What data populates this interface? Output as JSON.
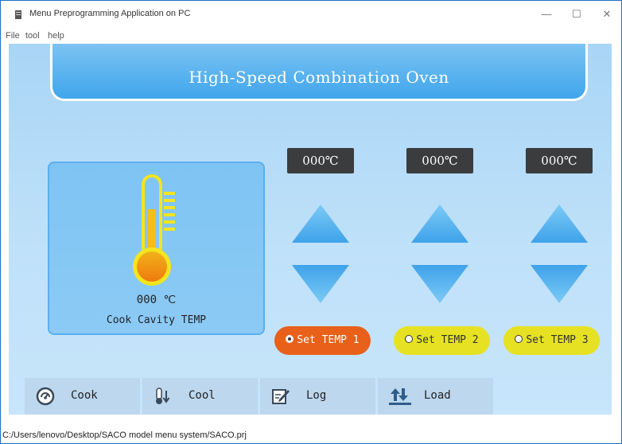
{
  "window": {
    "title": "Menu Preprogramming Application on PC",
    "controls": {
      "minimize": "—",
      "maximize": "☐",
      "close": "✕"
    }
  },
  "menu": [
    "File",
    "tool",
    "help"
  ],
  "header": {
    "title": "High-Speed Combination Oven"
  },
  "cavity": {
    "icon": "thermometer-icon",
    "value": "000 ℃",
    "label": "Cook Cavity TEMP"
  },
  "temps": [
    {
      "display": "000℃",
      "button_label": "Set TEMP 1",
      "selected": true
    },
    {
      "display": "000℃",
      "button_label": "Set TEMP 2",
      "selected": false
    },
    {
      "display": "000℃",
      "button_label": "Set TEMP 3",
      "selected": false
    }
  ],
  "nav": [
    {
      "label": "Cook",
      "icon": "gauge-icon"
    },
    {
      "label": "Cool",
      "icon": "thermometer-down-icon"
    },
    {
      "label": "Log",
      "icon": "edit-note-icon"
    },
    {
      "label": "Load",
      "icon": "sort-arrows-icon"
    }
  ],
  "status": {
    "path": "C:/Users/lenovo/Desktop/SACO model menu system/SACO.prj"
  },
  "colors": {
    "stage_bg": "#b8dcf7",
    "banner": "#40a6ec",
    "active_button": "#e8601a",
    "idle_button": "#e6e223",
    "temp_display": "#3a3c3e",
    "arrow": "#4aa9ee"
  }
}
